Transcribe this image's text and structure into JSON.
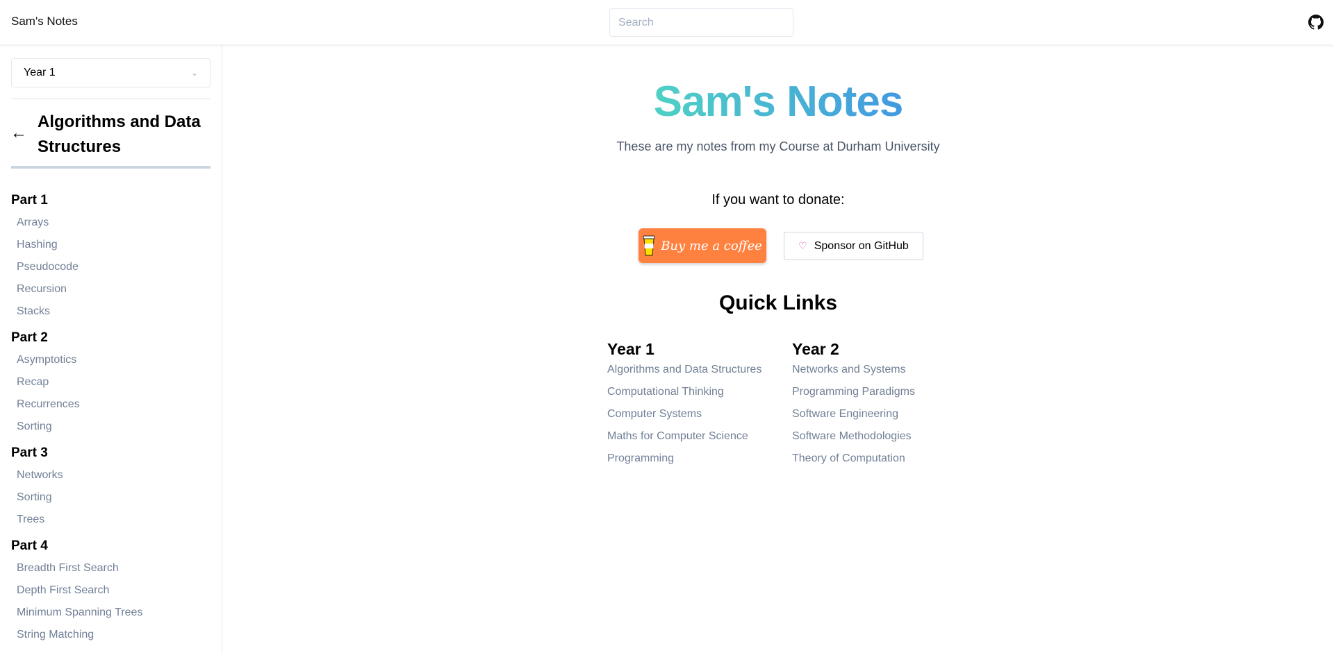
{
  "header": {
    "brand": "Sam's Notes",
    "search_placeholder": "Search",
    "github_icon": "github-icon"
  },
  "sidebar": {
    "year_select": "Year 1",
    "course_title": "Algorithms and Data Structures",
    "parts": [
      {
        "title": "Part 1",
        "items": [
          "Arrays",
          "Hashing",
          "Pseudocode",
          "Recursion",
          "Stacks"
        ]
      },
      {
        "title": "Part 2",
        "items": [
          "Asymptotics",
          "Recap",
          "Recurrences",
          "Sorting"
        ]
      },
      {
        "title": "Part 3",
        "items": [
          "Networks",
          "Sorting",
          "Trees"
        ]
      },
      {
        "title": "Part 4",
        "items": [
          "Breadth First Search",
          "Depth First Search",
          "Minimum Spanning Trees",
          "String Matching"
        ]
      }
    ]
  },
  "main": {
    "title": "Sam's Notes",
    "subtitle": "These are my notes from my Course at Durham University",
    "donate_label": "If you want to donate:",
    "coffee_button": "Buy me a coffee",
    "sponsor_button": "Sponsor on GitHub",
    "quick_links_title": "Quick Links",
    "columns": [
      {
        "title": "Year 1",
        "links": [
          "Algorithms and Data Structures",
          "Computational Thinking",
          "Computer Systems",
          "Maths for Computer Science",
          "Programming"
        ]
      },
      {
        "title": "Year 2",
        "links": [
          "Networks and Systems",
          "Programming Paradigms",
          "Software Engineering",
          "Software Methodologies",
          "Theory of Computation"
        ]
      }
    ]
  },
  "colors": {
    "gradient_start": "#4fd1c5",
    "gradient_end": "#4299e1",
    "coffee_bg": "#ff813f",
    "link": "#718096"
  }
}
